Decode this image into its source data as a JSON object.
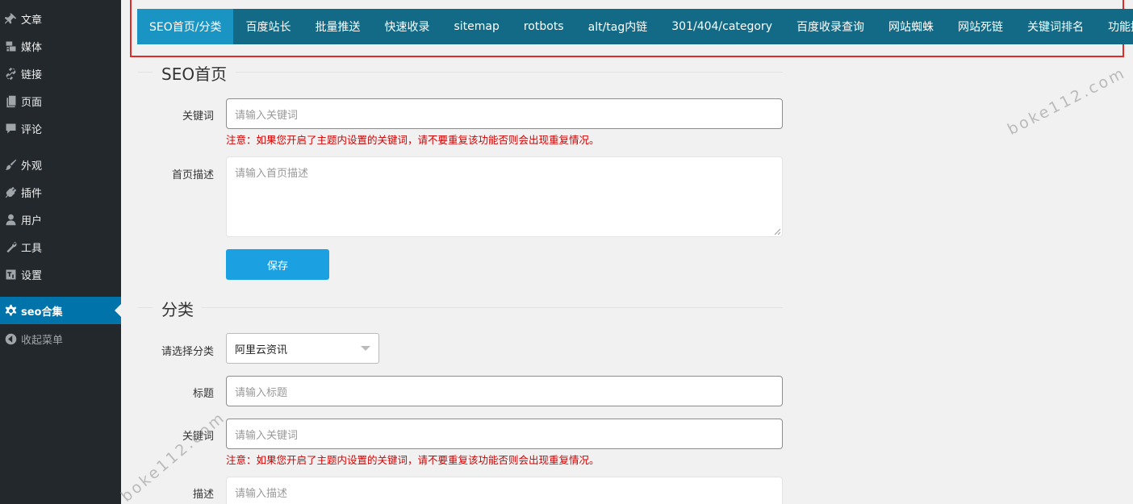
{
  "sidebar": {
    "items": [
      {
        "label": "文章",
        "icon": "pin-icon"
      },
      {
        "label": "媒体",
        "icon": "media-icon"
      },
      {
        "label": "链接",
        "icon": "link-icon"
      },
      {
        "label": "页面",
        "icon": "page-icon"
      },
      {
        "label": "评论",
        "icon": "comment-icon"
      },
      {
        "label": "外观",
        "icon": "brush-icon"
      },
      {
        "label": "插件",
        "icon": "plugin-icon"
      },
      {
        "label": "用户",
        "icon": "user-icon"
      },
      {
        "label": "工具",
        "icon": "wrench-icon"
      },
      {
        "label": "设置",
        "icon": "settings-icon"
      },
      {
        "label": "seo合集",
        "icon": "gear-icon"
      },
      {
        "label": "收起菜单",
        "icon": "collapse-icon"
      }
    ]
  },
  "tabs": [
    "SEO首页/分类",
    "百度站长",
    "批量推送",
    "快速收录",
    "sitemap",
    "rotbots",
    "alt/tag内链",
    "301/404/category",
    "百度收录查询",
    "网站蜘蛛",
    "网站死链",
    "关键词排名",
    "功能授权"
  ],
  "seo_home": {
    "title": "SEO首页",
    "keyword_label": "关键词",
    "keyword_placeholder": "请输入关键词",
    "note": "注意：如果您开启了主题内设置的关键词，请不要重复该功能否则会出现重复情况。",
    "desc_label": "首页描述",
    "desc_placeholder": "请输入首页描述",
    "save_label": "保存"
  },
  "category": {
    "title": "分类",
    "select_label": "请选择分类",
    "select_value": "阿里云资讯",
    "title_label": "标题",
    "title_placeholder": "请输入标题",
    "keyword_label": "关键词",
    "keyword_placeholder": "请输入关键词",
    "note": "注意：如果您开启了主题内设置的关键词，请不要重复该功能否则会出现重复情况。",
    "desc_label": "描述",
    "desc_placeholder": "请输入描述"
  },
  "watermarks": [
    "boke112.com",
    "boke112.com"
  ],
  "colors": {
    "sidebar_bg": "#23282d",
    "sidebar_active": "#0073aa",
    "tabbar_bg": "#126a86",
    "tab_active": "#1a95c3",
    "button": "#1ba1e2",
    "note": "#d10000",
    "highlight_frame": "#e02b2b"
  }
}
